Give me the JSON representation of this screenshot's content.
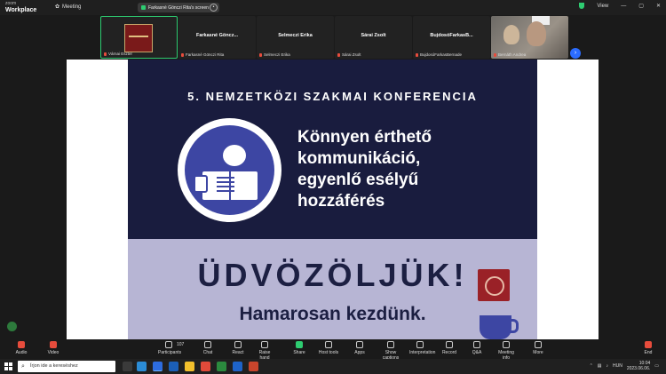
{
  "app": {
    "brand_top": "zoom",
    "brand_bottom": "Workplace",
    "meeting_label": "Meeting"
  },
  "share_pill": {
    "text": "Farkasné Gönczi Rita's screen"
  },
  "topright": {
    "view_label": "View"
  },
  "filmstrip": {
    "tiles": [
      {
        "name": "",
        "sub": "Várnai Eszter",
        "type": "image"
      },
      {
        "name": "Farkasné Göncz...",
        "sub": "Farkasné Gönczi Rita",
        "type": "name"
      },
      {
        "name": "Selmeczi Erika",
        "sub": "Selmeczi Erika",
        "type": "name"
      },
      {
        "name": "Sárai Zsolt",
        "sub": "Sárai Zsolt",
        "type": "name"
      },
      {
        "name": "BujdosóFarkasB...",
        "sub": "BujdosóFarkasBernade",
        "type": "name"
      },
      {
        "name": "",
        "sub": "Bernáth Andrea",
        "type": "camera"
      }
    ],
    "next_arrow": "›"
  },
  "slide": {
    "kicker": "5. NEMZETKÖZI SZAKMAI KONFERENCIA",
    "headline": [
      "Könnyen érthető",
      "kommunikáció,",
      "egyenlő esélyű",
      "hozzáférés"
    ],
    "welcome": "ÜDVÖZÖLJÜK!",
    "soon": "Hamarosan kezdünk."
  },
  "toolbar": {
    "items": [
      {
        "label": "Audio",
        "icon": "mic-muted-icon",
        "style": "red"
      },
      {
        "label": "Video",
        "icon": "video-off-icon",
        "style": "red"
      },
      {
        "label": "Participants",
        "icon": "participants-icon",
        "style": ""
      },
      {
        "label": "Chat",
        "icon": "chat-icon",
        "style": ""
      },
      {
        "label": "React",
        "icon": "react-icon",
        "style": ""
      },
      {
        "label": "Raise hand",
        "icon": "raise-hand-icon",
        "style": ""
      },
      {
        "label": "Share",
        "icon": "share-icon",
        "style": "green"
      },
      {
        "label": "Host tools",
        "icon": "host-tools-icon",
        "style": ""
      },
      {
        "label": "Apps",
        "icon": "apps-icon",
        "style": ""
      },
      {
        "label": "Show captions",
        "icon": "captions-icon",
        "style": ""
      },
      {
        "label": "Interpretation",
        "icon": "interpretation-icon",
        "style": ""
      },
      {
        "label": "Record",
        "icon": "record-icon",
        "style": ""
      },
      {
        "label": "Q&A",
        "icon": "qa-icon",
        "style": ""
      },
      {
        "label": "Meeting info",
        "icon": "info-icon",
        "style": ""
      },
      {
        "label": "More",
        "icon": "more-icon",
        "style": ""
      },
      {
        "label": "End",
        "icon": "end-icon",
        "style": "red"
      }
    ],
    "participants_count": "107"
  },
  "taskbar": {
    "search_placeholder": "Írjon ide a kereséshez",
    "lang": "HUN",
    "time": "10:04",
    "date": "2023.06.06."
  },
  "colors": {
    "banner": "#191c3e",
    "lower": "#b7b5d4",
    "logo": "#3d46a3",
    "active_border": "#2ecc71"
  }
}
